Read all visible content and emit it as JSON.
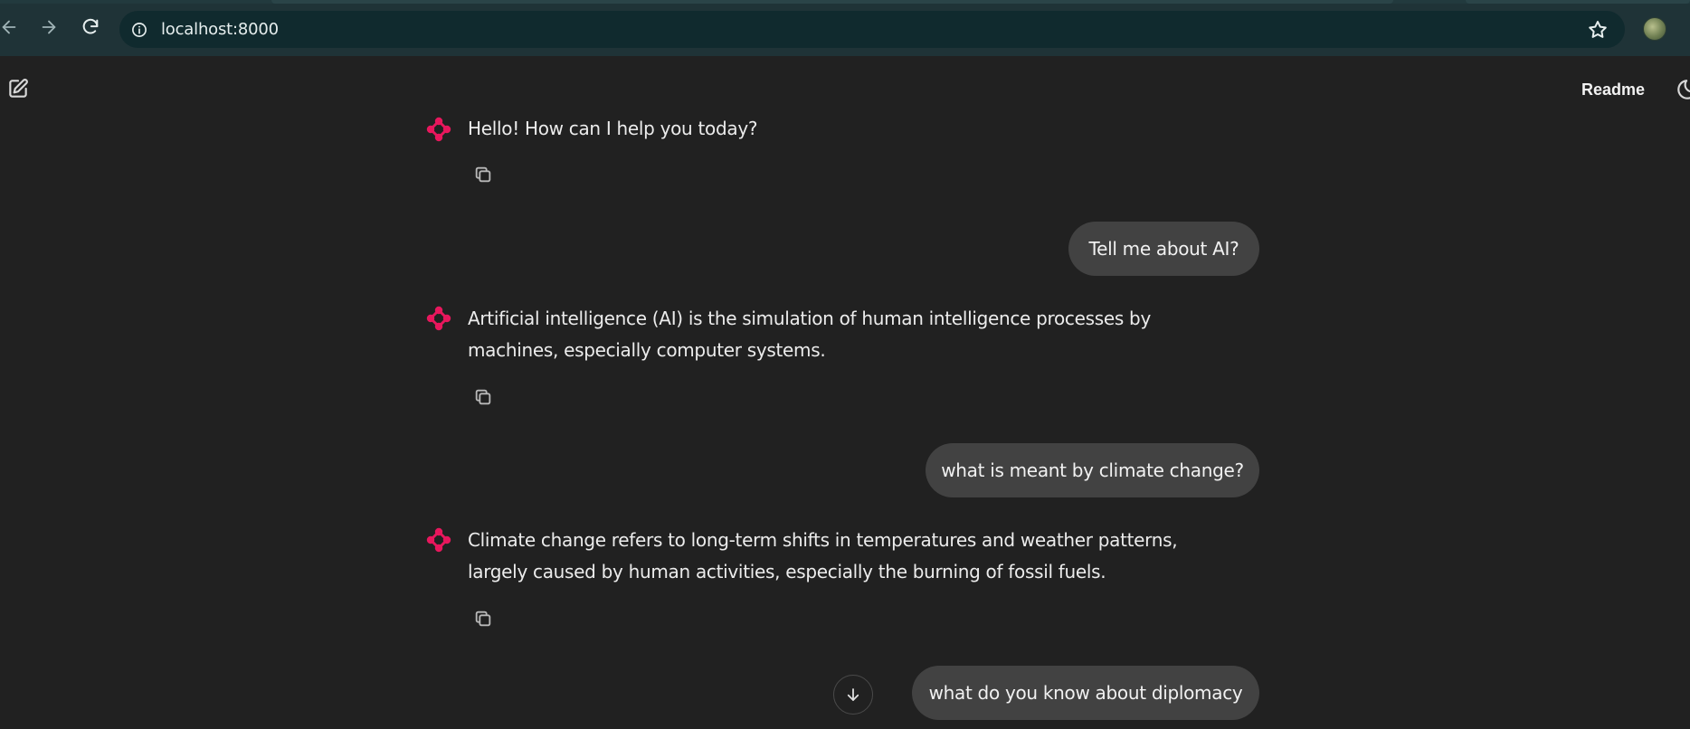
{
  "browser": {
    "url": "localhost:8000"
  },
  "header": {
    "readme_label": "Readme"
  },
  "messages": [
    {
      "role": "assistant",
      "text": "Hello! How can I help you today?"
    },
    {
      "role": "user",
      "text": "Tell me about AI?"
    },
    {
      "role": "assistant",
      "text": "Artificial intelligence (AI) is the simulation of human intelligence processes by machines, especially computer systems."
    },
    {
      "role": "user",
      "text": "what is meant by climate change?"
    },
    {
      "role": "assistant",
      "text": "Climate change refers to long-term shifts in temperatures and weather patterns, largely caused by human activities, especially the burning of fossil fuels."
    },
    {
      "role": "user",
      "text": "what do you know about diplomacy"
    }
  ],
  "icons": {
    "back": "arrow-left-icon",
    "forward": "arrow-right-icon",
    "reload": "reload-icon",
    "site_info": "info-icon",
    "bookmark": "star-icon",
    "new_chat": "edit-icon",
    "theme": "moon-icon",
    "bot": "sparkle-logo-icon",
    "copy": "copy-icon",
    "scroll_down": "arrow-down-icon"
  },
  "colors": {
    "background": "#212121",
    "user_bubble": "#424242",
    "bot_logo": "#e8175d",
    "browser_chrome": "#1f3337"
  }
}
